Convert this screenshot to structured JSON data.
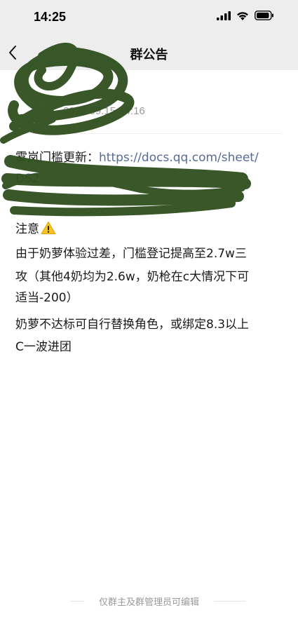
{
  "status_bar": {
    "time": "14:25",
    "icons": [
      "signal-icon",
      "wifi-icon",
      "battery-icon"
    ]
  },
  "nav": {
    "title": "群公告",
    "back_icon": "chevron-left-icon"
  },
  "post": {
    "date_partial": "2020.09.15  14:16",
    "link_label": "雾岚门槛更新：",
    "link_url_visible": "https://docs.qq.com/sheet/",
    "link_url_line2_partial": "DS2",
    "note_heading": "注意",
    "warning_icon": "warning-icon",
    "paragraph1_lines": [
      "由于奶萝体验过差，门槛登记提高至2.7w三",
      "攻（其他4奶均为2.6w，奶枪在c大情况下可",
      "适当-200）"
    ],
    "paragraph2_lines": [
      "奶萝不达标可自行替换角色，或绑定8.3以上",
      "C一波进团"
    ],
    "link_color": "#576b95",
    "redaction_color": "#2f4f1e"
  },
  "footer": {
    "text": "仅群主及群管理员可编辑"
  }
}
